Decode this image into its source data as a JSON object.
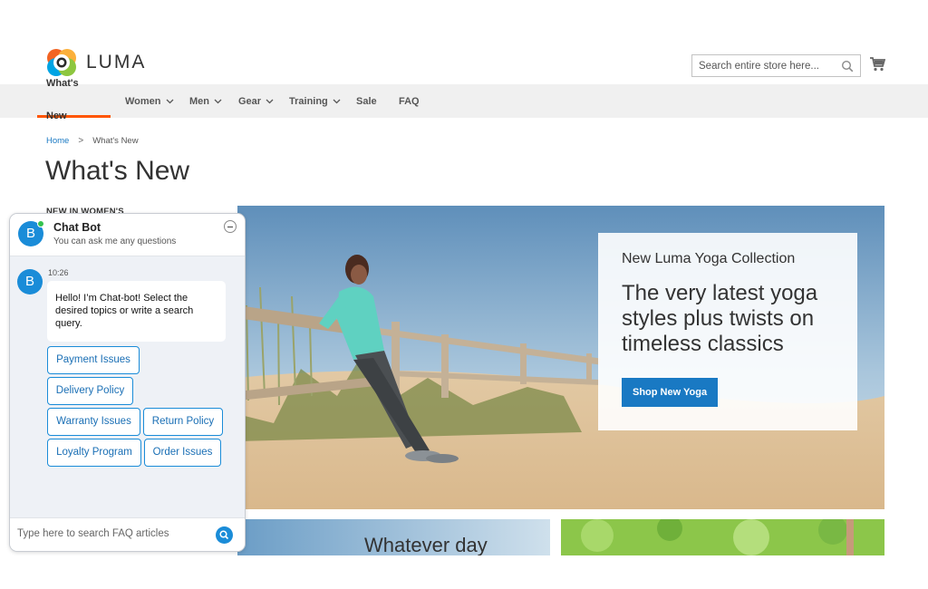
{
  "header": {
    "logo_text": "LUMA",
    "search_placeholder": "Search entire store here...",
    "cart_icon": "cart-icon",
    "search_icon": "search-icon"
  },
  "nav": {
    "items": [
      {
        "label": "What's New",
        "active": true,
        "has_dropdown": false
      },
      {
        "label": "Women",
        "active": false,
        "has_dropdown": true
      },
      {
        "label": "Men",
        "active": false,
        "has_dropdown": true
      },
      {
        "label": "Gear",
        "active": false,
        "has_dropdown": true
      },
      {
        "label": "Training",
        "active": false,
        "has_dropdown": true
      },
      {
        "label": "Sale",
        "active": false,
        "has_dropdown": false
      },
      {
        "label": "FAQ",
        "active": false,
        "has_dropdown": false
      }
    ]
  },
  "breadcrumb": {
    "home": "Home",
    "separator": ">",
    "current": "What's New"
  },
  "page": {
    "title": "What's New",
    "sidebar_heading": "NEW IN WOMEN'S"
  },
  "hero": {
    "subtitle": "New Luma Yoga Collection",
    "title": "The very latest yoga styles plus twists on timeless classics",
    "button_label": "Shop New Yoga"
  },
  "tiles": {
    "tile1_text": "Whatever day"
  },
  "chat": {
    "title": "Chat Bot",
    "subtitle": "You can ask me any questions",
    "avatar_letter": "B",
    "message_time": "10:26",
    "message_text": "Hello! I’m Chat-bot! Select the desired topics or write a search query.",
    "quick_replies": [
      "Payment Issues",
      "Delivery Policy",
      "Warranty Issues",
      "Return Policy",
      "Loyalty Program",
      "Order Issues"
    ],
    "input_placeholder": "Type here to search FAQ articles"
  },
  "colors": {
    "accent": "#1979c3",
    "nav_active_underline": "#ff5501",
    "chat_accent": "#1a8cd8",
    "online": "#35c24f"
  }
}
